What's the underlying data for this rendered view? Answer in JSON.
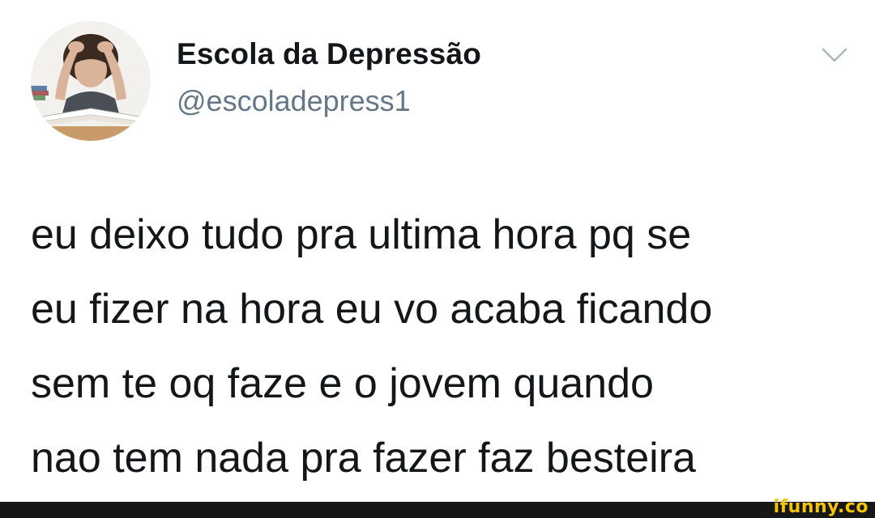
{
  "tweet": {
    "author_name": "Escola da Depressão",
    "author_handle": "@escoladepress1",
    "menu_icon": "chevron-down-icon",
    "text_lines": [
      "eu deixo tudo pra ultima hora pq se",
      "eu fizer na hora eu vo acaba ficando",
      "sem te oq faze e o jovem quando",
      "nao tem nada pra fazer faz besteira"
    ]
  },
  "watermark": {
    "text": "ifunny.co"
  },
  "colors": {
    "name": "#14171a",
    "handle": "#657786",
    "chevron": "#aab8c2",
    "footer": "#171717",
    "watermark": "#f5c400"
  }
}
